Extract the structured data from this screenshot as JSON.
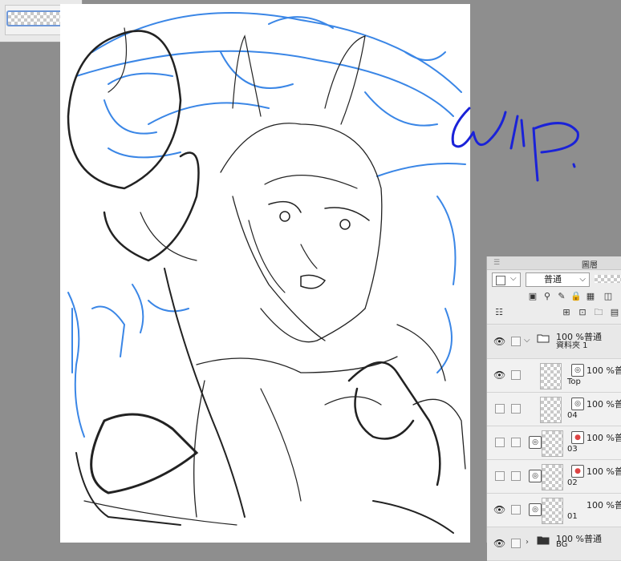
{
  "canvas": {
    "wip_text": "WIP."
  },
  "layer_panel": {
    "title": "圖層",
    "blend_mode": "普通",
    "layers": [
      {
        "kind": "folder",
        "opacity_mode": "100 %普通",
        "name": "資料夾 1",
        "visible": true,
        "expanded": true
      },
      {
        "kind": "raster",
        "opacity_mode": "100 %普",
        "name": "Top",
        "visible": true
      },
      {
        "kind": "raster",
        "opacity_mode": "100 %普",
        "name": "04",
        "visible": false
      },
      {
        "kind": "color",
        "opacity_mode": "100 %普",
        "name": "03",
        "visible": false
      },
      {
        "kind": "color",
        "opacity_mode": "100 %普",
        "name": "02",
        "visible": false
      },
      {
        "kind": "raster",
        "opacity_mode": "100 %普",
        "name": "01",
        "visible": true
      },
      {
        "kind": "folder",
        "opacity_mode": "100 %普通",
        "name": "BG",
        "visible": true,
        "expanded": false
      }
    ]
  },
  "icons": {
    "eye": "eye-icon",
    "folder": "folder-icon",
    "raster": "raster-layer-icon",
    "color": "color-layer-icon"
  },
  "colors": {
    "workspace": "#8e8e8e",
    "blue_sketch": "#3a86e6",
    "wip_ink": "#1a22d8",
    "panel": "#ececec"
  }
}
